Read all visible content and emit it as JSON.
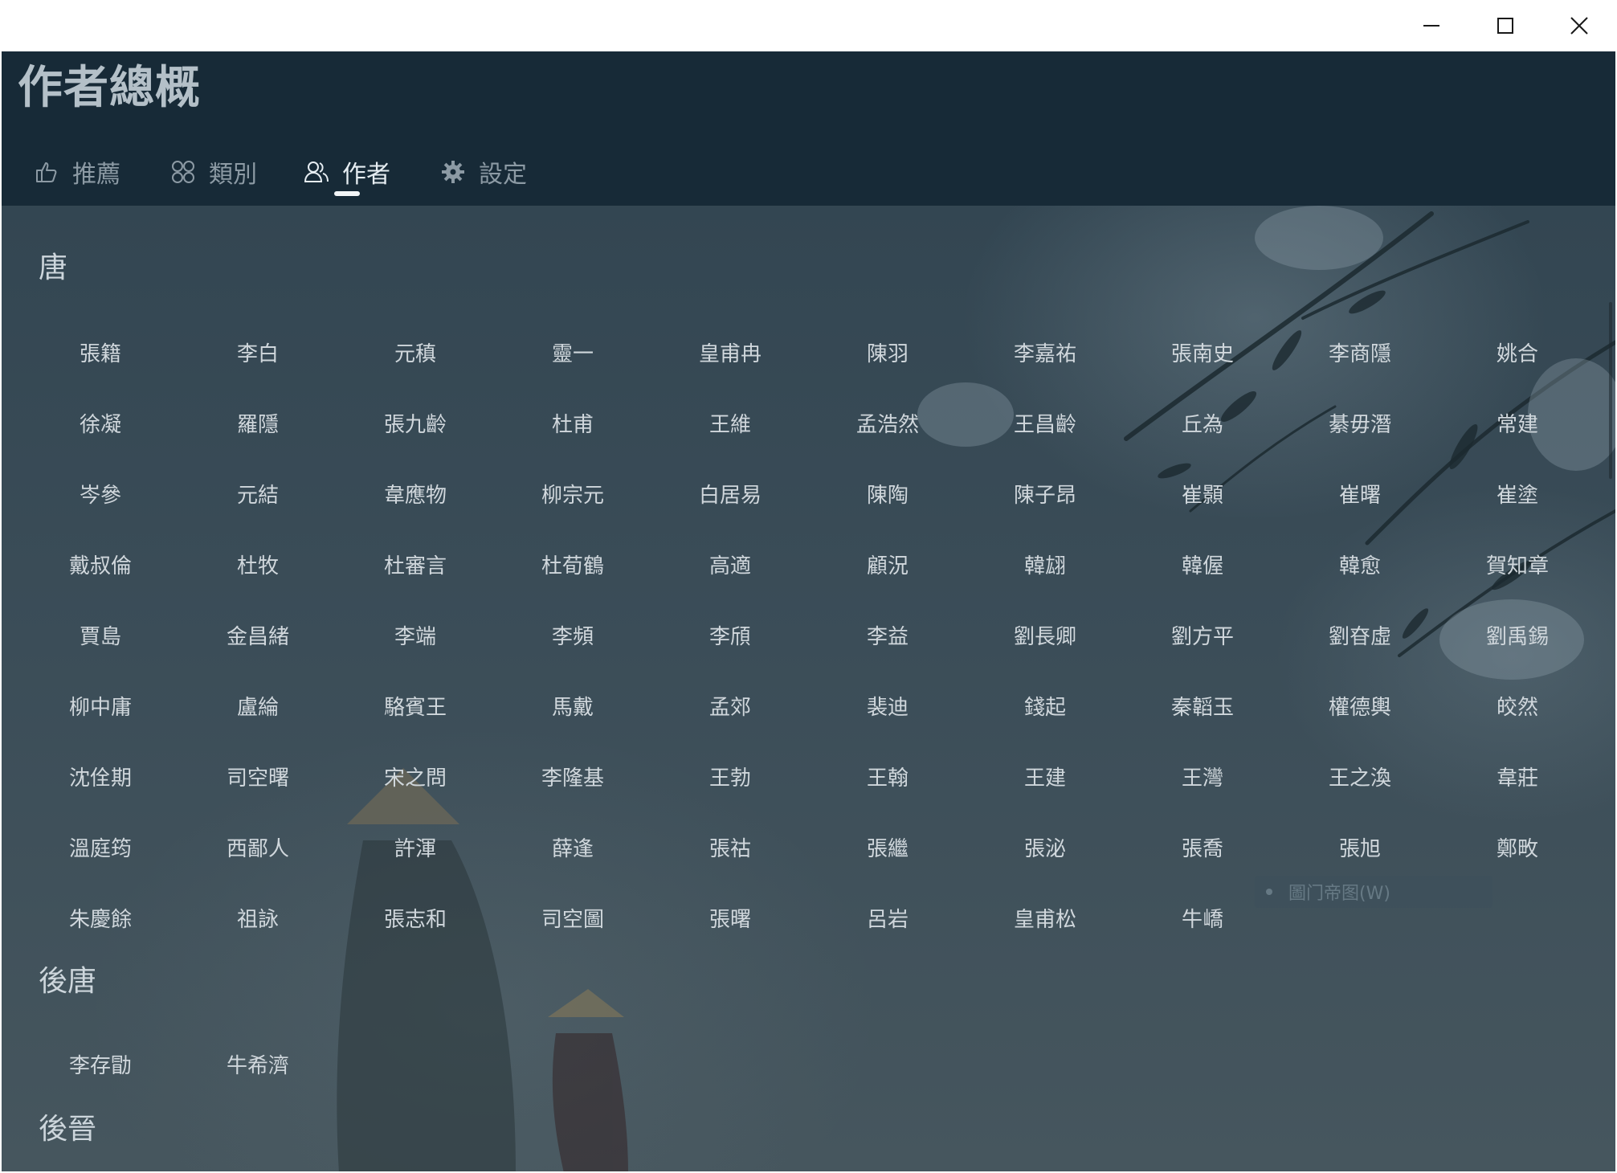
{
  "window": {
    "controls": {
      "minimize_icon": "minimize-icon",
      "maximize_icon": "maximize-icon",
      "close_icon": "close-icon"
    }
  },
  "header": {
    "title": "作者總概",
    "tabs": [
      {
        "label": "推薦",
        "icon": "recommend-icon"
      },
      {
        "label": "類別",
        "icon": "category-icon"
      },
      {
        "label": "作者",
        "icon": "authors-icon",
        "active": true
      },
      {
        "label": "設定",
        "icon": "settings-gear-icon"
      }
    ]
  },
  "sections": [
    {
      "title": "唐",
      "authors": [
        "張籍",
        "李白",
        "元稹",
        "靈一",
        "皇甫冉",
        "陳羽",
        "李嘉祐",
        "張南史",
        "李商隱",
        "姚合",
        "徐凝",
        "羅隱",
        "張九齡",
        "杜甫",
        "王維",
        "孟浩然",
        "王昌齡",
        "丘為",
        "綦毋潛",
        "常建",
        "岑參",
        "元結",
        "韋應物",
        "柳宗元",
        "白居易",
        "陳陶",
        "陳子昂",
        "崔顥",
        "崔曙",
        "崔塗",
        "戴叔倫",
        "杜牧",
        "杜審言",
        "杜荀鶴",
        "高適",
        "顧況",
        "韓翃",
        "韓偓",
        "韓愈",
        "賀知章",
        "賈島",
        "金昌緒",
        "李端",
        "李頻",
        "李頎",
        "李益",
        "劉長卿",
        "劉方平",
        "劉昚虛",
        "劉禹錫",
        "柳中庸",
        "盧綸",
        "駱賓王",
        "馬戴",
        "孟郊",
        "裴迪",
        "錢起",
        "秦韜玉",
        "權德輿",
        "皎然",
        "沈佺期",
        "司空曙",
        "宋之問",
        "李隆基",
        "王勃",
        "王翰",
        "王建",
        "王灣",
        "王之渙",
        "韋莊",
        "溫庭筠",
        "西鄙人",
        "許渾",
        "薛逢",
        "張祜",
        "張繼",
        "張泌",
        "張喬",
        "張旭",
        "鄭畋",
        "朱慶餘",
        "祖詠",
        "張志和",
        "司空圖",
        "張曙",
        "呂岩",
        "皇甫松",
        "牛嶠"
      ]
    },
    {
      "title": "後唐",
      "authors": [
        "李存勖",
        "牛希濟"
      ]
    },
    {
      "title": "後晉",
      "authors": []
    }
  ],
  "overlay": {
    "ghost_text": "圖门帝图(W)"
  }
}
